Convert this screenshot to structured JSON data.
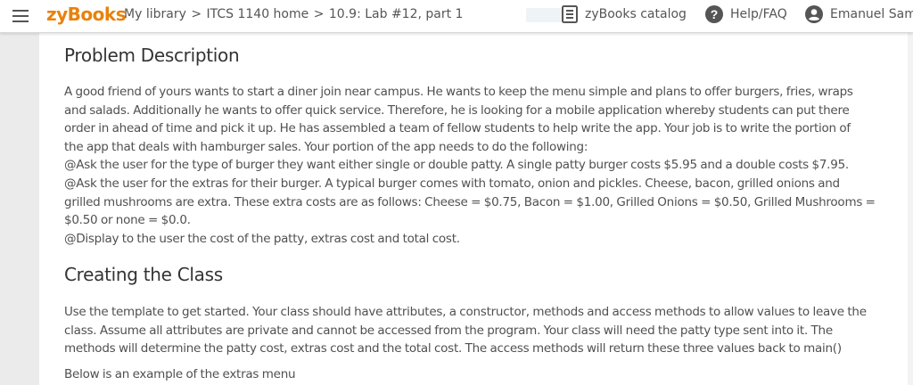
{
  "header": {
    "logo": "zyBooks",
    "breadcrumb": [
      "My library",
      "ITCS 1140 home",
      "10.9: Lab #12, part 1"
    ],
    "breadcrumb_sep": ">",
    "catalog_label": "zyBooks catalog",
    "help_label": "Help/FAQ",
    "user_label": "Emanuel Sama"
  },
  "section1": {
    "title": "Problem Description",
    "lines": [
      "A good friend of yours wants to start a diner join near campus. He wants to keep the menu simple and plans to offer burgers, fries, wraps",
      "and salads. Additionally he wants to offer quick service. Therefore, he is looking for a mobile application whereby students can put there",
      "order in ahead of time and pick it up. He has assembled a team of fellow students to help write the app. Your job is to write the portion of",
      "the app that deals with hamburger sales. Your portion of the app needs to do the following:",
      "@Ask the user for the type of burger they want either single or double patty. A single patty burger costs $5.95 and a double costs $7.95.",
      "@Ask the user for the extras for their burger. A typical burger comes with tomato, onion and pickles. Cheese, bacon, grilled onions and",
      "grilled mushrooms are extra. These extra costs are as follows: Cheese = $0.75, Bacon = $1.00, Grilled Onions = $0.50, Grilled Mushrooms =",
      "$0.50 or none = $0.0.",
      "@Display to the user the cost of the patty, extras cost and total cost."
    ]
  },
  "section2": {
    "title": "Creating the Class",
    "lines": [
      "Use the template to get started. Your class should have attributes, a constructor, methods and access methods to allow values to leave the",
      "class. Assume all attributes are private and cannot be accessed from the program. Your class will need the patty type sent into it. The",
      "methods will determine the patty cost, extras cost and the total cost. The access methods will return these three values back to main()"
    ],
    "note": "Below is an example of the extras menu"
  }
}
